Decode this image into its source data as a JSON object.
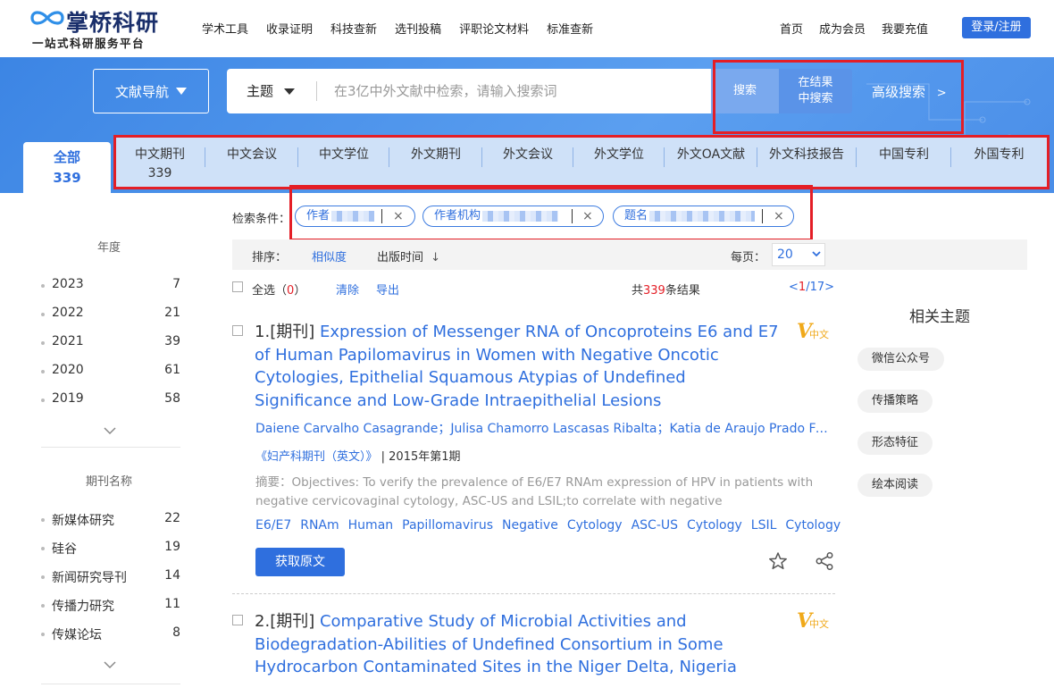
{
  "header": {
    "logo_text": "掌桥科研",
    "logo_sub": "一站式科研服务平台",
    "nav": [
      "学术工具",
      "收录证明",
      "科技查新",
      "选刊投稿",
      "评职论文材料",
      "标准查新"
    ],
    "right_nav": [
      "首页",
      "成为会员",
      "我要充值"
    ],
    "login_label": "登录/注册"
  },
  "search": {
    "nav_button": "文献导航",
    "scope": "主题",
    "placeholder": "在3亿中外文献中检索，请输入搜索词",
    "value": "",
    "search_btn": "搜索",
    "within_btn_line1": "在结果",
    "within_btn_line2": "中搜索",
    "advanced_btn": "高级搜索",
    "advanced_arrow": ">"
  },
  "tabs": {
    "all": {
      "label": "全部",
      "count": "339"
    },
    "items": [
      {
        "label": "中文期刊",
        "count": "339"
      },
      {
        "label": "中文会议",
        "count": ""
      },
      {
        "label": "中文学位",
        "count": ""
      },
      {
        "label": "外文期刊",
        "count": ""
      },
      {
        "label": "外文会议",
        "count": ""
      },
      {
        "label": "外文学位",
        "count": ""
      },
      {
        "label": "外文OA文献",
        "count": ""
      },
      {
        "label": "外文科技报告",
        "count": ""
      },
      {
        "label": "中国专利",
        "count": ""
      },
      {
        "label": "外国专利",
        "count": ""
      }
    ]
  },
  "sidebar": {
    "year_title": "年度",
    "years": [
      {
        "name": "2023",
        "count": "7"
      },
      {
        "name": "2022",
        "count": "21"
      },
      {
        "name": "2021",
        "count": "39"
      },
      {
        "name": "2020",
        "count": "61"
      },
      {
        "name": "2019",
        "count": "58"
      }
    ],
    "journal_title": "期刊名称",
    "journals": [
      {
        "name": "新媒体研究",
        "count": "22"
      },
      {
        "name": "硅谷",
        "count": "19"
      },
      {
        "name": "新闻研究导刊",
        "count": "14"
      },
      {
        "name": "传播力研究",
        "count": "11"
      },
      {
        "name": "传媒论坛",
        "count": "8"
      }
    ]
  },
  "conditions": {
    "label": "检索条件：",
    "chips": [
      {
        "field": "作者",
        "close": "×"
      },
      {
        "field": "作者机构",
        "close": "×"
      },
      {
        "field": "题名",
        "close": "×"
      }
    ]
  },
  "sort": {
    "label": "排序：",
    "relevance": "相似度",
    "date": "出版时间",
    "date_arrow": "↓",
    "per_page_label": "每页：",
    "per_page": "20"
  },
  "listhead": {
    "select_all": "全选",
    "open_paren": "（",
    "selected_count": "0",
    "close_paren": "）",
    "clear": "清除",
    "export": "导出",
    "total_pre": "共",
    "total": "339",
    "total_post": "条结果",
    "page_lt": "<",
    "page_current": "1",
    "page_rest": "/17>"
  },
  "results": [
    {
      "index": "1.",
      "type": "[期刊]",
      "title": "Expression of Messenger RNA of Oncoproteins E6 and E7 of Human Papilomavirus in Women with Negative Oncotic Cytologies, Epithelial Squamous Atypias of Undefined Significance and Low-Grade Intraepithelial Lesions",
      "badge_v": "V",
      "badge_lang": "中文",
      "authors": "Daiene Carvalho Casagrande；Julisa Chamorro Lascasas Ribalta；Katia de Araujo Prado Ferreira",
      "source": "《妇产科期刊（英文）》",
      "issue": " | 2015年第1期",
      "abstract": "摘要：Objectives: To verify the prevalence of E6/E7 RNAm expression of HPV in patients with negative cervicovaginal cytology, ASC-US and LSIL;to correlate with negative anatomopathological...",
      "keywords": [
        "E6/E7",
        "RNAm",
        "Human",
        "Papillomavirus",
        "Negative",
        "Cytology",
        "ASC-US",
        "Cytology",
        "LSIL",
        "Cytology"
      ],
      "button": "获取原文"
    },
    {
      "index": "2.",
      "type": "[期刊]",
      "title": "Comparative Study of Microbial Activities and Biodegradation-Abilities of Undefined Consortium in Some Hydrocarbon Contaminated Sites in the Niger Delta, Nigeria",
      "badge_v": "V",
      "badge_lang": "中文"
    }
  ],
  "related": {
    "title": "相关主题",
    "tags": [
      "微信公众号",
      "传播策略",
      "形态特征",
      "绘本阅读"
    ]
  },
  "colors": {
    "accent": "#2f6fde",
    "highlight_box": "#e41e26",
    "badge": "#f0a91a"
  }
}
